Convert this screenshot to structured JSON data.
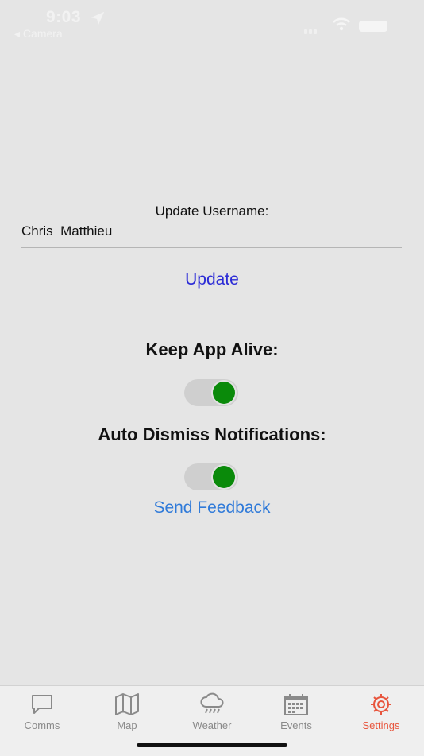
{
  "status_bar": {
    "time": "9:03",
    "back_app": "◂ Camera"
  },
  "settings": {
    "update_username_label": "Update Username:",
    "username_value": "Chris  Matthieu",
    "update_button": "Update",
    "keep_alive_label": "Keep App Alive:",
    "keep_alive_on": true,
    "auto_dismiss_label": "Auto Dismiss Notifications:",
    "auto_dismiss_on": true,
    "send_feedback": "Send Feedback"
  },
  "tabs": [
    {
      "label": "Comms",
      "icon": "chat-bubble-icon",
      "active": false
    },
    {
      "label": "Map",
      "icon": "map-icon",
      "active": false
    },
    {
      "label": "Weather",
      "icon": "cloud-rain-icon",
      "active": false
    },
    {
      "label": "Events",
      "icon": "calendar-icon",
      "active": false
    },
    {
      "label": "Settings",
      "icon": "gear-icon",
      "active": true
    }
  ],
  "colors": {
    "background": "#e5e5e5",
    "accent_active_tab": "#e8553d",
    "toggle_on": "#0a8a0a",
    "update_link": "#2b2bd6",
    "feedback_link": "#2f7ad9",
    "tab_inactive": "#8a8a8a"
  }
}
